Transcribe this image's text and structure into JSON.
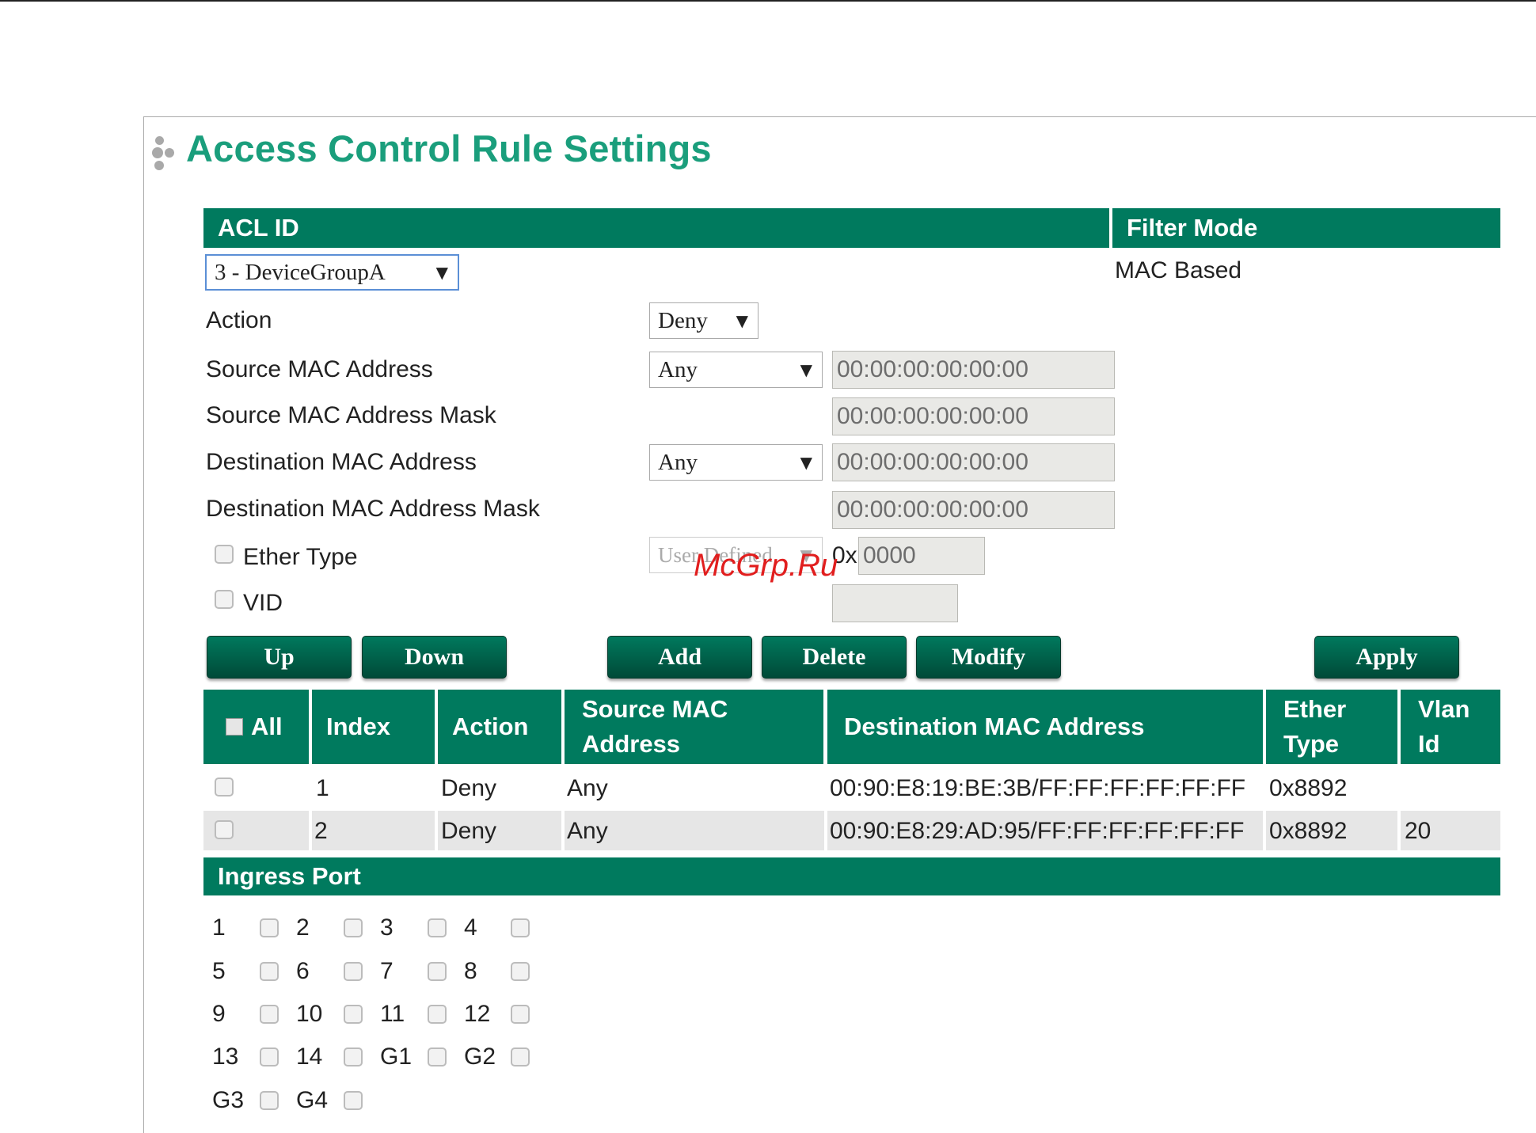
{
  "page": {
    "title": "Access Control Rule Settings"
  },
  "header": {
    "acl_id_label": "ACL ID",
    "filter_mode_label": "Filter Mode"
  },
  "acl_select": {
    "value": "3 - DeviceGroupA"
  },
  "filter_mode": {
    "value": "MAC Based"
  },
  "form": {
    "action": {
      "label": "Action",
      "value": "Deny"
    },
    "src_mac": {
      "label": "Source MAC Address",
      "select": "Any",
      "value": "00:00:00:00:00:00"
    },
    "src_mask": {
      "label": "Source MAC Address Mask",
      "value": "00:00:00:00:00:00"
    },
    "dst_mac": {
      "label": "Destination MAC Address",
      "select": "Any",
      "value": "00:00:00:00:00:00"
    },
    "dst_mask": {
      "label": "Destination MAC Address Mask",
      "value": "00:00:00:00:00:00"
    },
    "ether_type": {
      "label": "Ether Type",
      "select": "User Defined",
      "prefix": "0x",
      "value": "0000"
    },
    "vid": {
      "label": "VID",
      "value": ""
    }
  },
  "buttons": {
    "up": "Up",
    "down": "Down",
    "add": "Add",
    "delete": "Delete",
    "modify": "Modify",
    "apply": "Apply"
  },
  "table": {
    "columns": [
      "All",
      "Index",
      "Action",
      "Source MAC Address",
      "Destination MAC Address",
      "Ether Type",
      "Vlan Id"
    ],
    "rows": [
      {
        "index": "1",
        "action": "Deny",
        "src": "Any",
        "dst": "00:90:E8:19:BE:3B/FF:FF:FF:FF:FF:FF",
        "ether": "0x8892",
        "vlan": ""
      },
      {
        "index": "2",
        "action": "Deny",
        "src": "Any",
        "dst": "00:90:E8:29:AD:95/FF:FF:FF:FF:FF:FF",
        "ether": "0x8892",
        "vlan": "20"
      }
    ]
  },
  "ingress": {
    "title": "Ingress Port",
    "ports": [
      "1",
      "2",
      "3",
      "4",
      "5",
      "6",
      "7",
      "8",
      "9",
      "10",
      "11",
      "12",
      "13",
      "14",
      "G1",
      "G2",
      "G3",
      "G4"
    ]
  },
  "watermark": "McGrp.Ru",
  "colors": {
    "accent": "#007a5e",
    "title": "#1a9e7c"
  }
}
